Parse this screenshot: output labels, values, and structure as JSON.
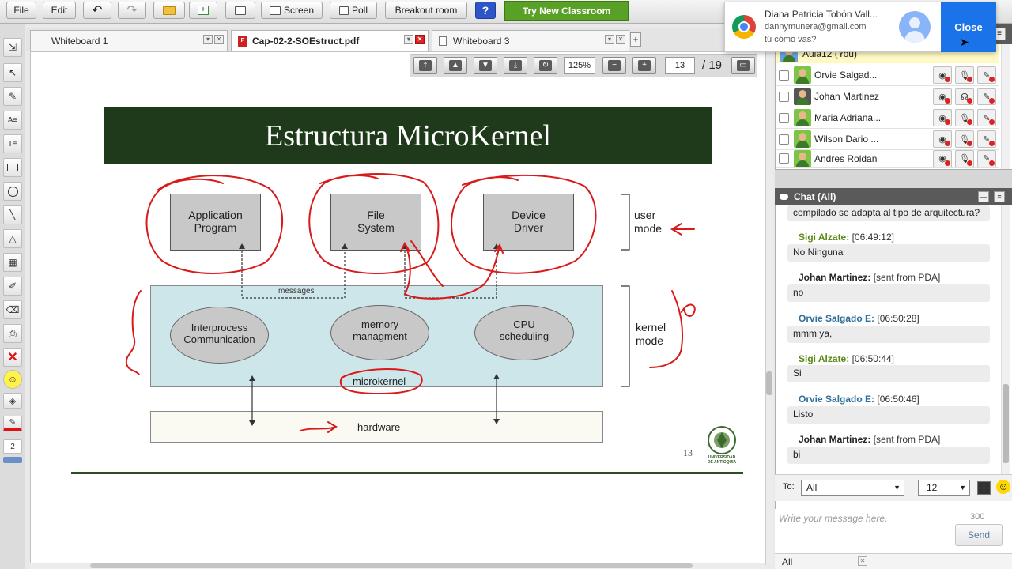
{
  "toolbar": {
    "file": "File",
    "edit": "Edit",
    "screen": "Screen",
    "poll": "Poll",
    "breakout": "Breakout room",
    "help": "?",
    "try_new": "Try New Classroom"
  },
  "tabs": [
    {
      "label": "Whiteboard 1"
    },
    {
      "label": "Cap-02-2-SOEstruct.pdf"
    },
    {
      "label": "Whiteboard 3"
    },
    {
      "label": "+"
    }
  ],
  "pdf_nav": {
    "zoom": "125%",
    "page": "13",
    "total": "/ 19"
  },
  "slide": {
    "title": "Estructura MicroKernel",
    "boxes": [
      "Application\nProgram",
      "File\nSystem",
      "Device\nDriver"
    ],
    "ellipses": [
      "Interprocess\nCommunication",
      "memory\nmanagment",
      "CPU\nscheduling"
    ],
    "messages_label": "messages",
    "microkernel": "microkernel",
    "hardware": "hardware",
    "user_mode": "user\nmode",
    "kernel_mode": "kernel\nmode",
    "page_number": "13",
    "logo_text": "UNIVERSIDAD\nDE ANTIOQUIA"
  },
  "tool_page_label": "2",
  "notification": {
    "name": "Diana Patricia Tobón Vall...",
    "email": "dannymunera@gmail.com",
    "message": "tú cómo vas?",
    "close": "Close"
  },
  "participants": {
    "self": "Aula12 (You)",
    "list": [
      {
        "name": "Orvie Salgad..."
      },
      {
        "name": "Johan Martinez"
      },
      {
        "name": "Maria Adriana..."
      },
      {
        "name": "Wilson Dario ..."
      },
      {
        "name": "Andres Roldan"
      }
    ]
  },
  "chat": {
    "header": "Chat (All)",
    "first_line": "compilado se adapta al tipo de arquitectura?",
    "messages": [
      {
        "sender": "Sigi Alzate:",
        "meta": "[06:49:12]",
        "text": "No Ninguna",
        "color": "#5a8a16"
      },
      {
        "sender": "Johan Martinez:",
        "meta": "[sent from PDA]",
        "text": "no",
        "color": "#222222"
      },
      {
        "sender": "Orvie Salgado E:",
        "meta": "[06:50:28]",
        "text": "mmm ya,",
        "color": "#2f6f9a"
      },
      {
        "sender": "Sigi Alzate:",
        "meta": "[06:50:44]",
        "text": "Si",
        "color": "#5a8a16"
      },
      {
        "sender": "Orvie Salgado E:",
        "meta": "[06:50:46]",
        "text": "Listo",
        "color": "#2f6f9a"
      },
      {
        "sender": "Johan Martinez:",
        "meta": "[sent from PDA]",
        "text": "bi",
        "color": "#222222"
      }
    ],
    "to_label": "To:",
    "to_value": "All",
    "font_size": "12",
    "placeholder": "Write your message here.",
    "char_count": "300",
    "send": "Send",
    "bottom_filter": "All"
  },
  "colors": {
    "slide_title_bg": "#1f3a1a",
    "try_new_bg": "#58a026",
    "close_bg": "#1a73e8",
    "annotation": "#d91a1a"
  }
}
